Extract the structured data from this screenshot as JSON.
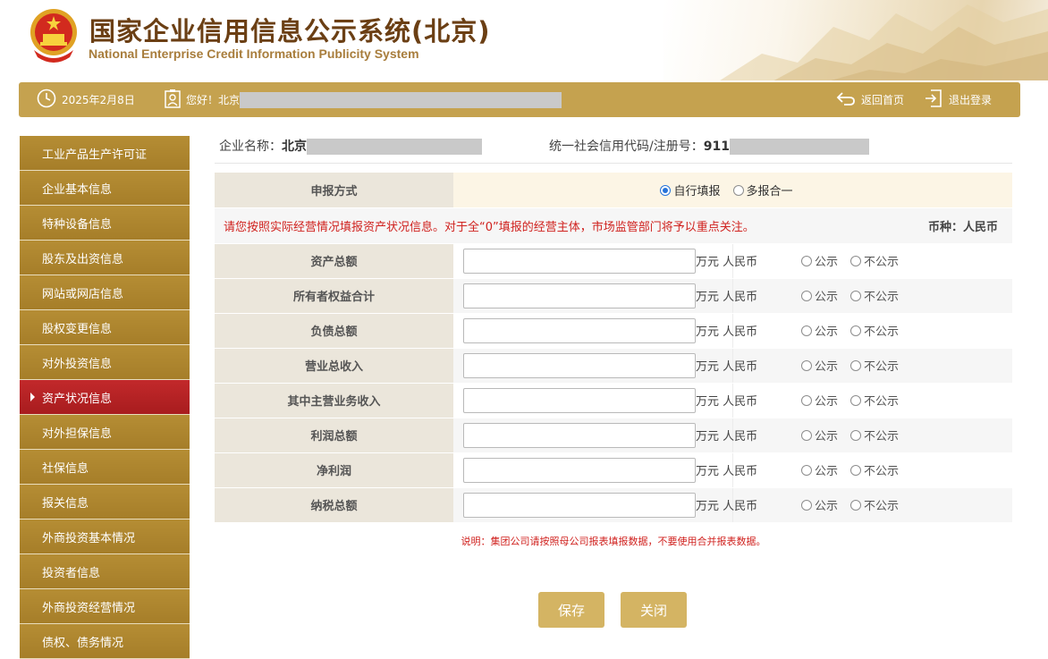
{
  "header": {
    "title_cn": "国家企业信用信息公示系统(北京)",
    "title_en": "National Enterprise Credit Information Publicity System"
  },
  "topbar": {
    "date": "2025年2月8日",
    "greeting": "您好！北京",
    "home_label": "返回首页",
    "logout_label": "退出登录"
  },
  "sidebar": {
    "items": [
      {
        "label": "工业产品生产许可证",
        "active": false
      },
      {
        "label": "企业基本信息",
        "active": false
      },
      {
        "label": "特种设备信息",
        "active": false
      },
      {
        "label": "股东及出资信息",
        "active": false
      },
      {
        "label": "网站或网店信息",
        "active": false
      },
      {
        "label": "股权变更信息",
        "active": false
      },
      {
        "label": "对外投资信息",
        "active": false
      },
      {
        "label": "资产状况信息",
        "active": true
      },
      {
        "label": "对外担保信息",
        "active": false
      },
      {
        "label": "社保信息",
        "active": false
      },
      {
        "label": "报关信息",
        "active": false
      },
      {
        "label": "外商投资基本情况",
        "active": false
      },
      {
        "label": "投资者信息",
        "active": false
      },
      {
        "label": "外商投资经营情况",
        "active": false
      },
      {
        "label": "债权、债务情况",
        "active": false
      }
    ]
  },
  "enterprise": {
    "name_label": "企业名称：",
    "name_value": "北京",
    "code_label": "统一社会信用代码/注册号：",
    "code_value": "911"
  },
  "report_mode": {
    "label": "申报方式",
    "option_self": "自行填报",
    "option_multi": "多报合一",
    "selected": "自行填报"
  },
  "notice": {
    "text": "请您按照实际经营情况填报资产状况信息。对于全“0”填报的经营主体，市场监管部门将予以重点关注。",
    "currency": "币种：人民币"
  },
  "fields": [
    {
      "label": "资产总额",
      "value": "",
      "unit": "万元 人民币",
      "public": "公示",
      "private": "不公示"
    },
    {
      "label": "所有者权益合计",
      "value": "",
      "unit": "万元 人民币",
      "public": "公示",
      "private": "不公示"
    },
    {
      "label": "负债总额",
      "value": "",
      "unit": "万元 人民币",
      "public": "公示",
      "private": "不公示"
    },
    {
      "label": "营业总收入",
      "value": "",
      "unit": "万元 人民币",
      "public": "公示",
      "private": "不公示"
    },
    {
      "label": "其中主营业务收入",
      "value": "",
      "unit": "万元 人民币",
      "public": "公示",
      "private": "不公示"
    },
    {
      "label": "利润总额",
      "value": "",
      "unit": "万元 人民币",
      "public": "公示",
      "private": "不公示"
    },
    {
      "label": "净利润",
      "value": "",
      "unit": "万元 人民币",
      "public": "公示",
      "private": "不公示"
    },
    {
      "label": "纳税总额",
      "value": "",
      "unit": "万元 人民币",
      "public": "公示",
      "private": "不公示"
    }
  ],
  "footnote": "说明：集团公司请按照母公司报表填报数据，不要使用合并报表数据。",
  "buttons": {
    "save": "保存",
    "close": "关闭"
  },
  "colors": {
    "brand_gold": "#c5a24f",
    "sidebar_gold": "#ab832d",
    "active_red": "#b32224",
    "notice_red": "#d0221f",
    "title_brown": "#6b3f14"
  }
}
